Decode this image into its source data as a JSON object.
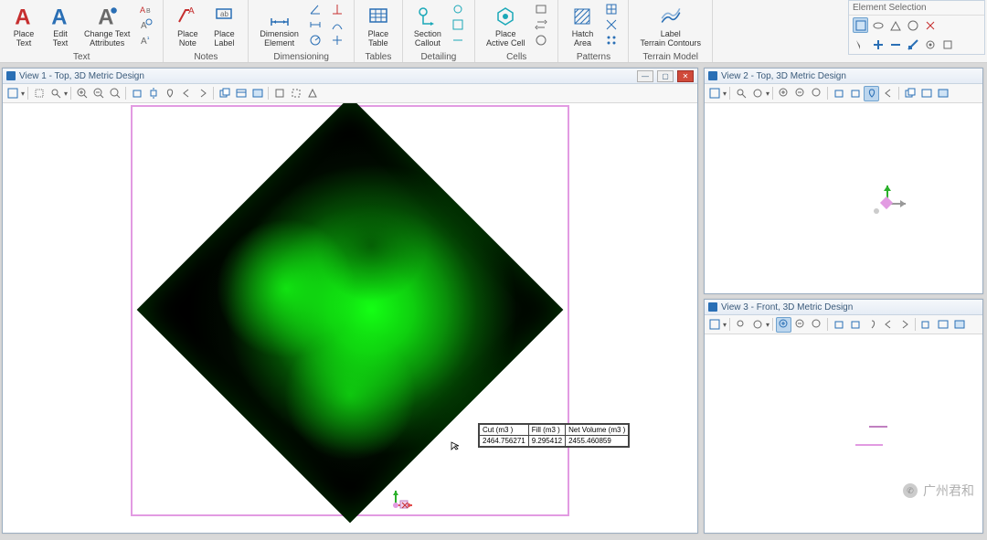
{
  "ribbon": {
    "groups": [
      {
        "label": "Text",
        "items": [
          {
            "label": "Place\nText",
            "name": "place-text-button",
            "icon": "A-red"
          },
          {
            "label": "Edit\nText",
            "name": "edit-text-button",
            "icon": "A-blue"
          },
          {
            "label": "Change Text\nAttributes",
            "name": "change-text-attributes-button",
            "icon": "A-gray"
          }
        ],
        "small": []
      },
      {
        "label": "Notes",
        "items": [
          {
            "label": "Place\nNote",
            "name": "place-note-button",
            "icon": "note"
          },
          {
            "label": "Place\nLabel",
            "name": "place-label-button",
            "icon": "label"
          }
        ]
      },
      {
        "label": "Dimensioning",
        "items": [
          {
            "label": "Dimension\nElement",
            "name": "dimension-element-button",
            "icon": "dim"
          }
        ],
        "small": []
      },
      {
        "label": "Tables",
        "items": [
          {
            "label": "Place\nTable",
            "name": "place-table-button",
            "icon": "table"
          }
        ]
      },
      {
        "label": "Detailing",
        "items": [
          {
            "label": "Section\nCallout",
            "name": "section-callout-button",
            "icon": "callout"
          }
        ],
        "small": []
      },
      {
        "label": "Cells",
        "items": [
          {
            "label": "Place\nActive Cell",
            "name": "place-active-cell-button",
            "icon": "cell"
          }
        ],
        "small": []
      },
      {
        "label": "Patterns",
        "items": [
          {
            "label": "Hatch\nArea",
            "name": "hatch-area-button",
            "icon": "hatch"
          }
        ],
        "small": []
      },
      {
        "label": "Terrain Model",
        "items": [
          {
            "label": "Label\nTerrain Contours",
            "name": "label-terrain-contours-button",
            "icon": "terrain"
          }
        ]
      }
    ]
  },
  "element_selection_label": "Element Selection",
  "views": {
    "v1": {
      "title": "View 1 - Top, 3D Metric Design"
    },
    "v2": {
      "title": "View 2 - Top, 3D Metric Design"
    },
    "v3": {
      "title": "View 3 - Front, 3D Metric Design"
    }
  },
  "data_table": {
    "headers": [
      "Cut (m3 )",
      "Fill (m3 )",
      "Net Volume (m3 )"
    ],
    "row": [
      "2464.756271",
      "9.295412",
      "2455.460859"
    ]
  },
  "watermark": "广州君和"
}
